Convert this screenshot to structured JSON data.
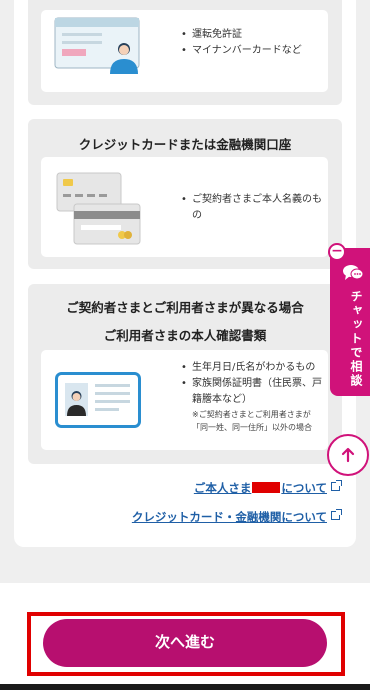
{
  "section1": {
    "items": [
      "運転免許証",
      "マイナンバーカードなど"
    ]
  },
  "section2": {
    "title": "クレジットカードまたは金融機関口座",
    "items": [
      "ご契約者さまご本人名義のもの"
    ]
  },
  "section3": {
    "title_line1": "ご契約者さまとご利用者さまが異なる場合",
    "title_line2": "ご利用者さまの本人確認書類",
    "items": [
      "生年月日/氏名がわかるもの",
      "家族関係証明書（住民票、戸籍謄本など）"
    ],
    "note": "※ご契約者さまとご利用者さまが「同一姓、同一住所」以外の場合"
  },
  "links": {
    "identity_prefix": "ご本人さま",
    "identity_suffix": "について",
    "credit": "クレジットカード・金融機関について"
  },
  "chat": {
    "label": "チャットで相談",
    "minus": "−"
  },
  "next_button": "次へ進む",
  "colors": {
    "accent": "#d0127a",
    "button": "#b70f6f",
    "link": "#1f5fa6",
    "highlight": "#e00000"
  }
}
